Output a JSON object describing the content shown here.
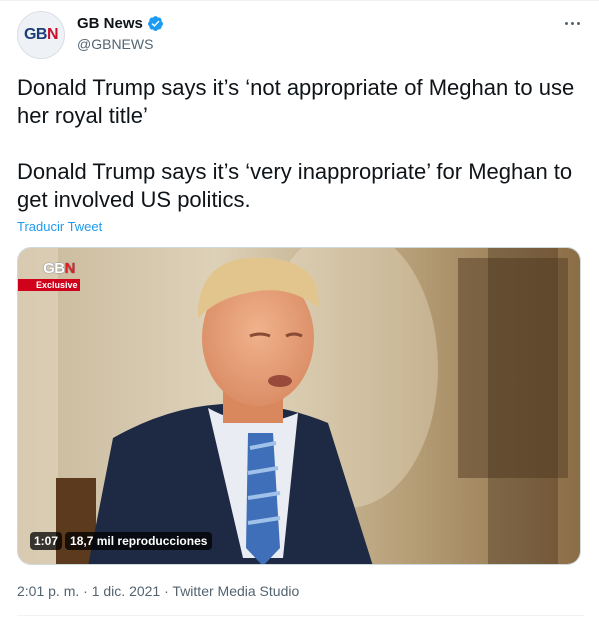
{
  "author": {
    "display_name": "GB News",
    "handle": "@GBNEWS",
    "verified": true,
    "avatar_logo": {
      "g": "G",
      "b": "B",
      "n": "N"
    }
  },
  "tweet": {
    "text": "Donald Trump says it’s ‘not appropriate of Meghan to use her royal title’\n\nDonald Trump says it’s ‘very inappropriate’ for Meghan to get involved US politics.",
    "translate_link": "Traducir Tweet"
  },
  "media": {
    "overlay_logo": {
      "gb": "GB",
      "n": "N"
    },
    "badge": "Exclusive",
    "duration": "1:07",
    "views": "18,7 mil reproducciones"
  },
  "footer": {
    "time": "2:01 p. m.",
    "separator": " · ",
    "date": "1 dic. 2021",
    "source": "Twitter Media Studio"
  },
  "colors": {
    "accent": "#1d9bf0",
    "brand_blue": "#1b3d7a",
    "brand_red": "#c8102e",
    "muted": "#536471"
  }
}
